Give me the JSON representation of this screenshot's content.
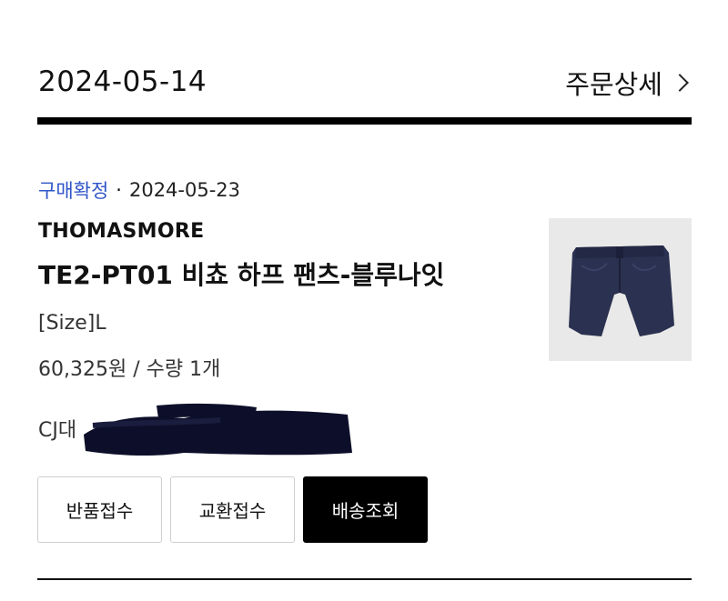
{
  "order": {
    "date": "2024-05-14",
    "detail_link_label": "주문상세"
  },
  "item": {
    "status_label": "구매확정",
    "status_separator": "·",
    "status_date": "2024-05-23",
    "brand": "THOMASMORE",
    "product_name": "TE2-PT01 비쵸 하프 팬츠-블루나잇",
    "option": "[Size]L",
    "price_quantity": "60,325원 / 수량 1개",
    "courier": "CJ대",
    "thumbnail_icon": "navy-shorts-image"
  },
  "actions": {
    "return_label": "반품접수",
    "exchange_label": "교환접수",
    "tracking_label": "배송조회"
  },
  "colors": {
    "status_accent": "#2f55c8",
    "primary_button": "#000000",
    "product_navy": "#2b3150"
  }
}
